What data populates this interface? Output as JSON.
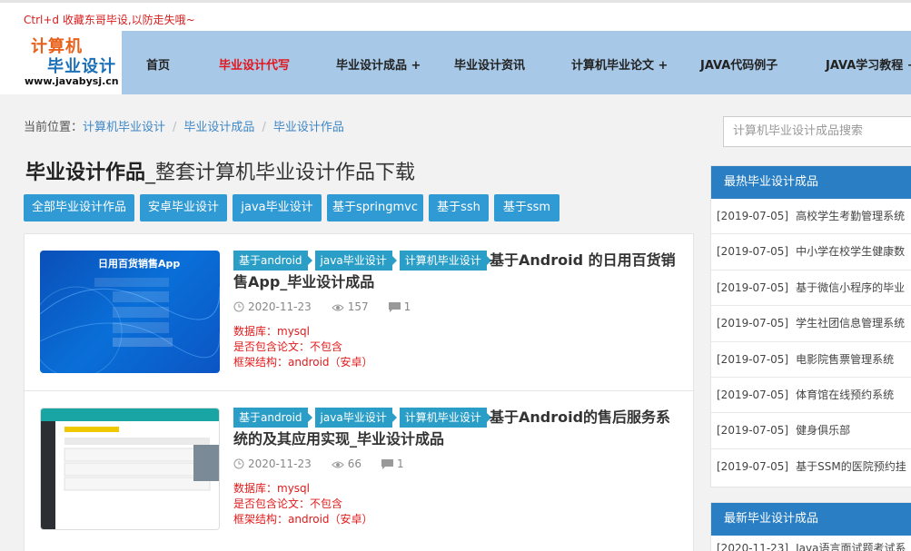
{
  "topbar": {
    "tip": "Ctrl+d 收藏东哥毕设,以防走失哦~"
  },
  "logo": {
    "line1": "计算机",
    "line2": "毕业设计",
    "line3": "www.javabysj.cn"
  },
  "nav": [
    "首页",
    "毕业设计代写",
    "毕业设计成品 +",
    "毕业设计资讯",
    "计算机毕业论文 +",
    "JAVA代码例子",
    "JAVA学习教程 +"
  ],
  "nav_active_color": "#e4141b",
  "breadcrumb": {
    "prefix": "当前位置：",
    "items": [
      "计算机毕业设计",
      "毕业设计成品",
      "毕业设计作品"
    ]
  },
  "page_title": {
    "main": "毕业设计作品",
    "sub": "_整套计算机毕业设计作品下载"
  },
  "filters": [
    "全部毕业设计作品",
    "安卓毕业设计",
    "java毕业设计",
    "基于springmvc",
    "基于ssh",
    "基于ssm"
  ],
  "items": [
    {
      "tags": [
        "基于android",
        "java毕业设计",
        "计算机毕业设计"
      ],
      "title": "基于Android 的日用百货销售App_毕业设计成品",
      "date": "2020-11-23",
      "views": "157",
      "comments": "1",
      "db": "数据库：mysql",
      "thesis": "是否包含论文：不包含",
      "framework": "框架结构：android（安卓）",
      "thumb_text": "日用百货销售App"
    },
    {
      "tags": [
        "基于android",
        "java毕业设计",
        "计算机毕业设计"
      ],
      "title": "基于Android的售后服务系统的及其应用实现_毕业设计成品",
      "date": "2020-11-23",
      "views": "66",
      "comments": "1",
      "db": "数据库：mysql",
      "thesis": "是否包含论文：不包含",
      "framework": "框架结构：android（安卓）"
    }
  ],
  "search": {
    "placeholder": "计算机毕业设计成品搜索"
  },
  "hot": {
    "title": "最热毕业设计成品",
    "rows": [
      {
        "date": "[2019-07-05]",
        "name": "高校学生考勤管理系统"
      },
      {
        "date": "[2019-07-05]",
        "name": "中小学在校学生健康数"
      },
      {
        "date": "[2019-07-05]",
        "name": "基于微信小程序的毕业"
      },
      {
        "date": "[2019-07-05]",
        "name": "学生社团信息管理系统"
      },
      {
        "date": "[2019-07-05]",
        "name": "电影院售票管理系统"
      },
      {
        "date": "[2019-07-05]",
        "name": "体育馆在线预约系统"
      },
      {
        "date": "[2019-07-05]",
        "name": "健身俱乐部"
      },
      {
        "date": "[2019-07-05]",
        "name": "基于SSM的医院预约挂"
      }
    ]
  },
  "newest": {
    "title": "最新毕业设计成品",
    "rows": [
      {
        "date": "[2020-11-23]",
        "name": "Java语言面试题考试系"
      }
    ]
  }
}
